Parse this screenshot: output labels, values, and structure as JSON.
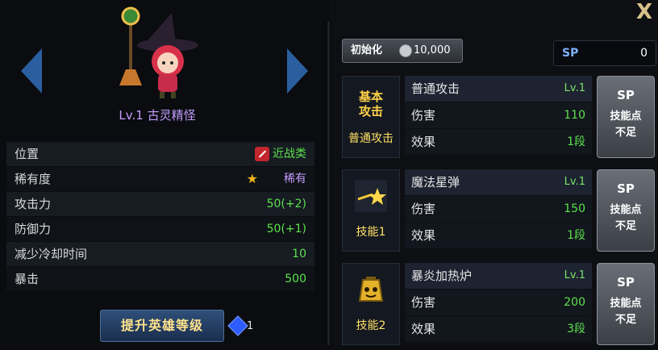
{
  "hero": {
    "name": "Lv.1 古灵精怪",
    "upgrade_button": "提升英雄等级",
    "gem_count": "1",
    "stats": [
      {
        "label": "位置",
        "value": "近战类"
      },
      {
        "label": "稀有度",
        "value": "稀有"
      },
      {
        "label": "攻击力",
        "value": "50(+2)"
      },
      {
        "label": "防御力",
        "value": "50(+1)"
      },
      {
        "label": "减少冷却时间",
        "value": "10"
      },
      {
        "label": "暴击",
        "value": "500"
      }
    ]
  },
  "panel": {
    "close": "X",
    "reset_label": "初始化",
    "reset_cost": "10,000",
    "sp_label": "SP",
    "sp_value": "0"
  },
  "skills": [
    {
      "icon_text": "基本\n攻击",
      "icon_label": "普通攻击",
      "name": "普通攻击",
      "level": "Lv.1",
      "row1_label": "伤害",
      "row1_value": "110",
      "row2_label": "效果",
      "row2_value": "1段",
      "sp_title": "SP",
      "sp_line1": "技能点",
      "sp_line2": "不足"
    },
    {
      "icon_text": "",
      "icon_label": "技能1",
      "name": "魔法星弹",
      "level": "Lv.1",
      "row1_label": "伤害",
      "row1_value": "150",
      "row2_label": "效果",
      "row2_value": "1段",
      "sp_title": "SP",
      "sp_line1": "技能点",
      "sp_line2": "不足"
    },
    {
      "icon_text": "",
      "icon_label": "技能2",
      "name": "暴炎加热炉",
      "level": "Lv.1",
      "row1_label": "伤害",
      "row1_value": "200",
      "row2_label": "效果",
      "row2_value": "3段",
      "sp_title": "SP",
      "sp_line1": "技能点",
      "sp_line2": "不足"
    }
  ],
  "colors": {
    "value_green": "#5be34d",
    "rare_purple": "#c59cff",
    "skill_label_yellow": "#ffe066"
  },
  "icons": {
    "prev": "chevron-left-icon",
    "next": "chevron-right-icon",
    "position": "sword-icon",
    "rarity": "star-icon",
    "coin": "coin-icon",
    "gem": "gem-icon"
  }
}
